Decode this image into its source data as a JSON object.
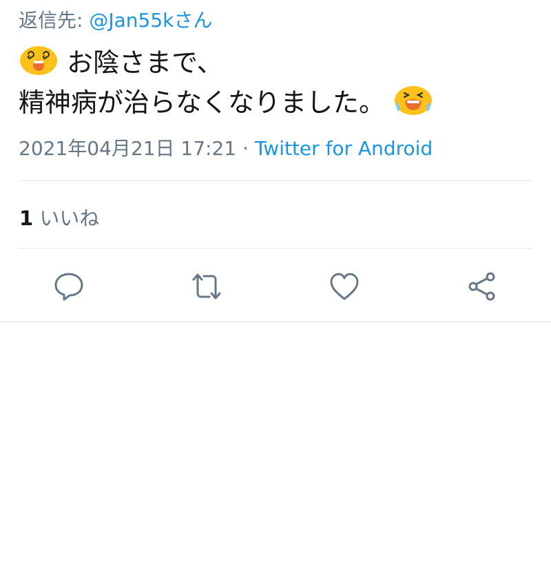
{
  "reply": {
    "prefix": "返信先:",
    "handle": "@Jan55kさん"
  },
  "tweet": {
    "line1_text": "お陰さまで、",
    "line1_emoji": "dizzy-face-emoji",
    "line2_text": "精神病が治らなくなりました。",
    "line2_emoji": "loudly-crying-face-emoji"
  },
  "meta": {
    "timestamp": "2021年04月21日 17:21",
    "separator": "·",
    "source": "Twitter for Android"
  },
  "likes": {
    "count": "1",
    "label": "いいね"
  },
  "actions": {
    "reply_icon": "speech-bubble-icon",
    "retweet_icon": "retweet-arrows-icon",
    "like_icon": "heart-icon",
    "share_icon": "share-nodes-icon"
  },
  "colors": {
    "link": "#1b95e0",
    "secondary_text": "#657786",
    "primary_text": "#14171a",
    "divider": "#e1e8ed",
    "emoji_yellow": "#fcc21b",
    "emoji_mouth": "#ed6c30"
  }
}
